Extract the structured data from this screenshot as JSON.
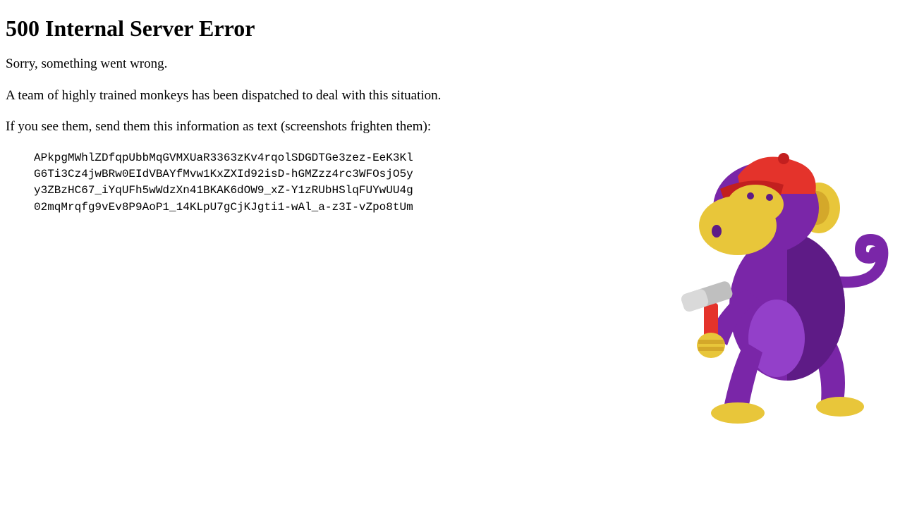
{
  "title": "500 Internal Server Error",
  "message1": "Sorry, something went wrong.",
  "message2": "A team of highly trained monkeys has been dispatched to deal with this situation.",
  "message3": "If you see them, send them this information as text (screenshots frighten them):",
  "errorCode": "APkpgMWhlZDfqpUbbMqGVMXUaR3363zKv4rqolSDGDTGe3zez-EeK3Kl\nG6Ti3Cz4jwBRw0EIdVBAYfMvw1KxZXId92isD-hGMZzz4rc3WFOsjO5y\ny3ZBzHC67_iYqUFh5wWdzXn41BKAK6dOW9_xZ-Y1zRUbHSlqFUYwUU4g\n02mqMrqfg9vEv8P9AoP1_14KLpU7gCjKJgti1-wAl_a-z3I-vZpo8tUm",
  "icon": "monkey-with-hammer"
}
